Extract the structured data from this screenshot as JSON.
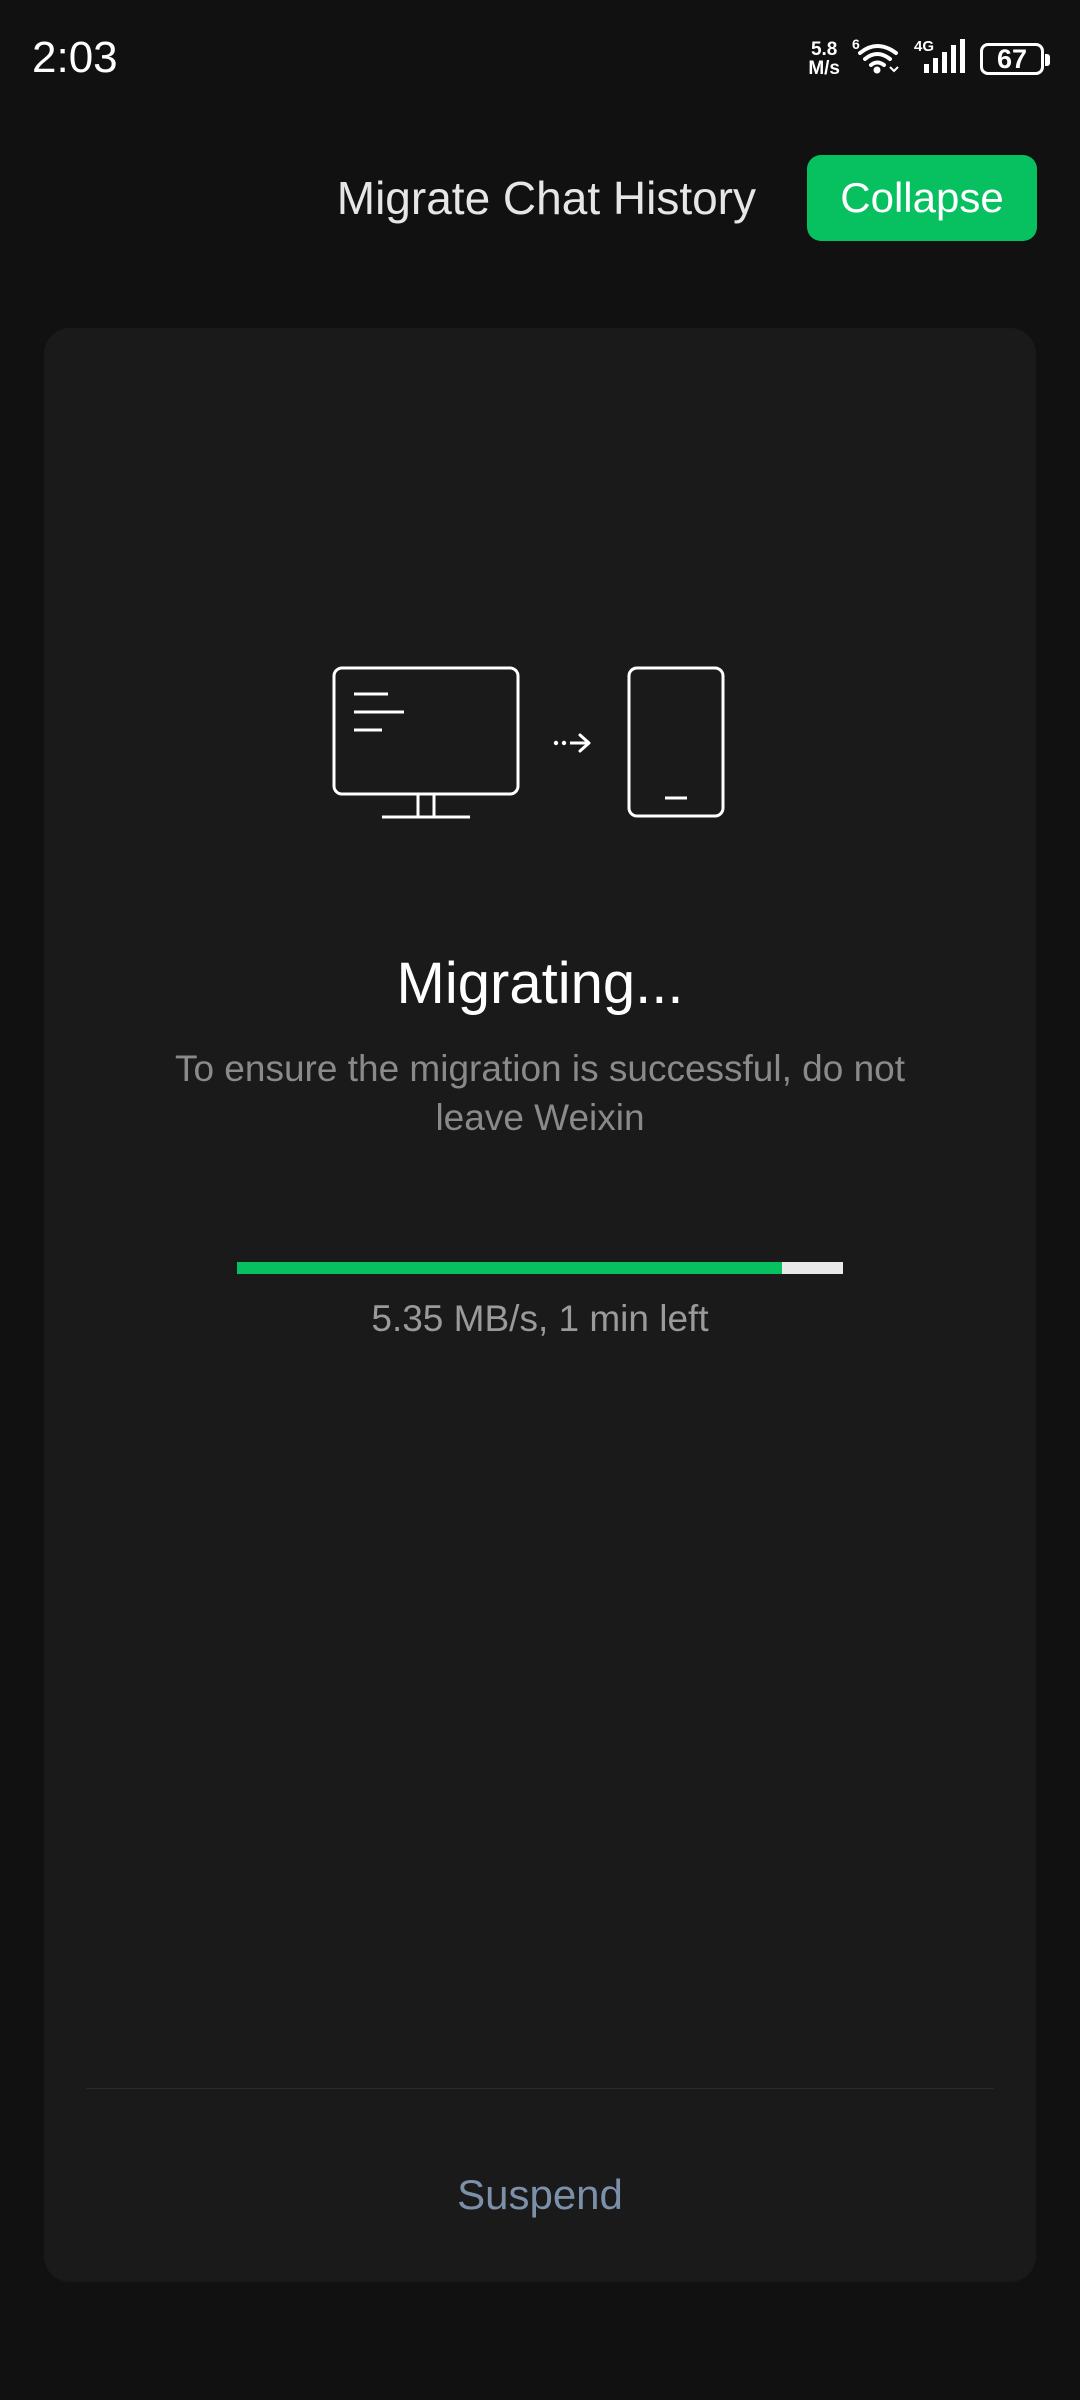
{
  "status_bar": {
    "time": "2:03",
    "net_speed_value": "5.8",
    "net_speed_unit": "M/s",
    "wifi_icon": "wifi-icon",
    "cellular_label": "4G",
    "signal_icon": "cellular-signal-icon",
    "battery_level": "67"
  },
  "header": {
    "title": "Migrate Chat History",
    "collapse_label": "Collapse"
  },
  "migration": {
    "illustration_icons": [
      "desktop-monitor-icon",
      "dotted-arrow-right-icon",
      "phone-icon"
    ],
    "status_title": "Migrating...",
    "warning": "To ensure the migration is successful, do not leave Weixin",
    "progress_fraction": 0.9,
    "progress_text": "5.35 MB/s, 1 min left",
    "suspend_label": "Suspend"
  },
  "colors": {
    "accent": "#07c160",
    "background": "#111111",
    "card": "#1a1a1a",
    "link": "#7d90a9"
  }
}
